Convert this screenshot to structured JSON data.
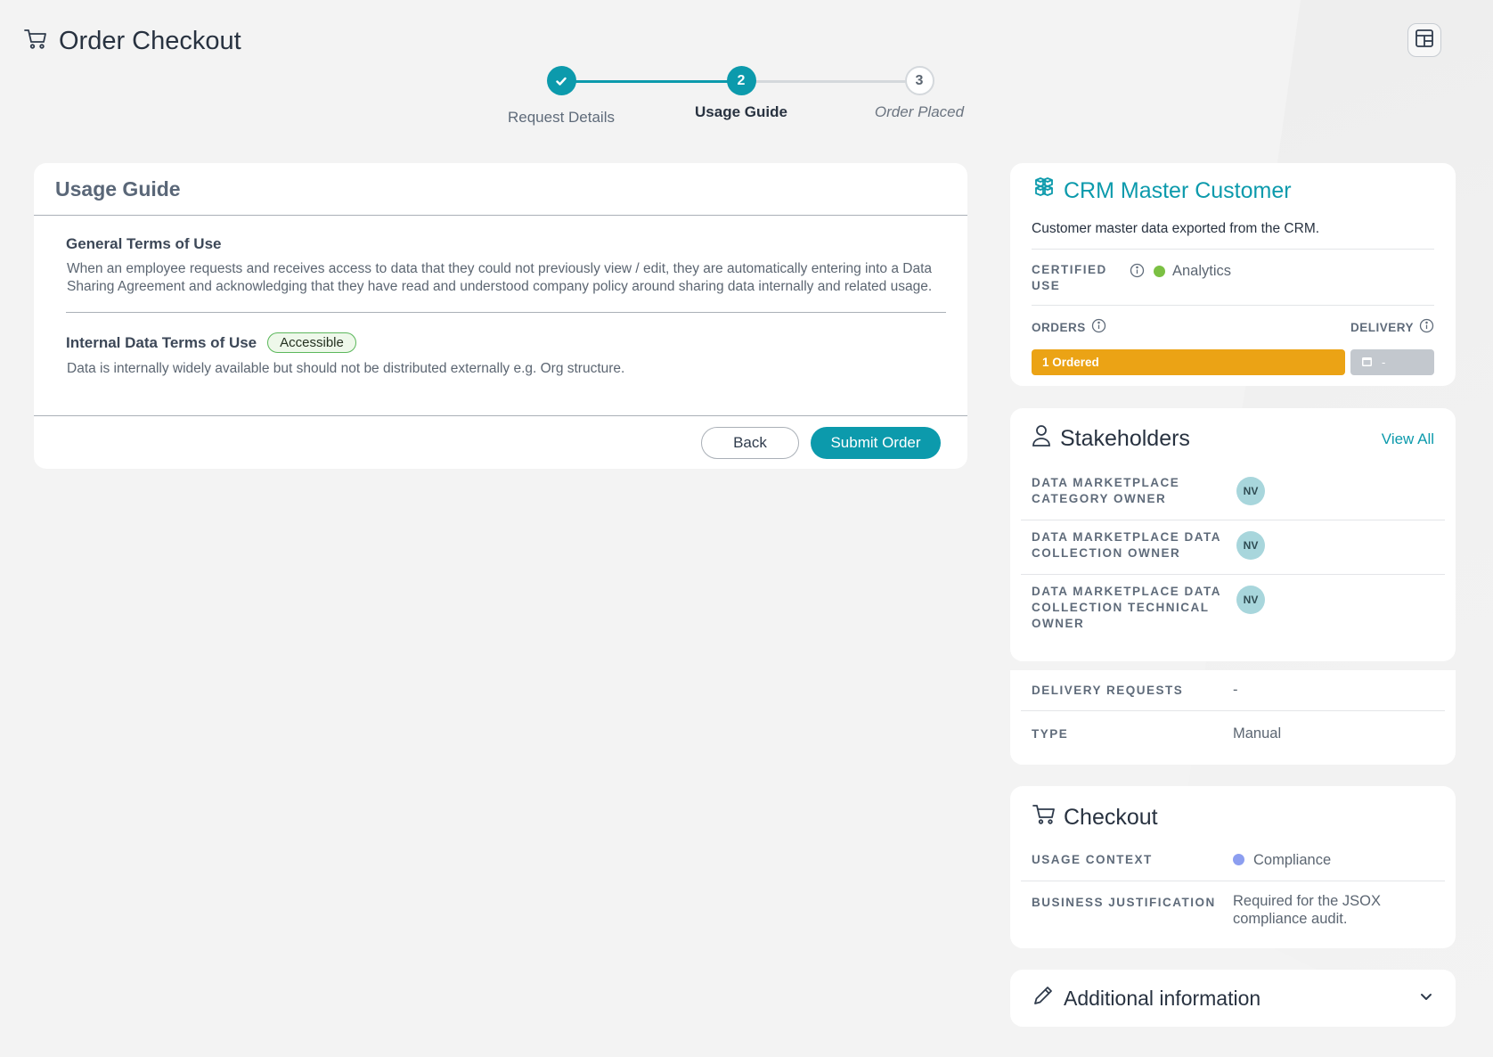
{
  "header": {
    "title": "Order Checkout",
    "icon": "cart-icon"
  },
  "stepper": {
    "steps": [
      {
        "label": "Request Details",
        "state": "complete",
        "number": "✓"
      },
      {
        "label": "Usage Guide",
        "state": "active",
        "number": "2"
      },
      {
        "label": "Order Placed",
        "state": "pending",
        "number": "3"
      }
    ]
  },
  "usage": {
    "title": "Usage Guide",
    "general_title": "General Terms of Use",
    "general_text": "When an employee requests and receives access to data that they could not previously view / edit, they are automatically entering into a Data Sharing Agreement and acknowledging that they have read and understood company policy around sharing data internally and related usage.",
    "internal_title": "Internal Data Terms of Use",
    "internal_badge": "Accessible",
    "internal_text": "Data is internally widely available but should not be distributed externally e.g. Org structure.",
    "back_label": "Back",
    "submit_label": "Submit Order"
  },
  "product": {
    "title": "CRM Master Customer",
    "description": "Customer master data exported from the CRM.",
    "certified_label": "CERTIFIED USE",
    "certified_value": "Analytics",
    "certified_color": "#7bc043",
    "orders_label": "ORDERS",
    "delivery_label": "DELIVERY",
    "ordered_text": "1 Ordered",
    "delivery_value": "-",
    "ordered_color": "#eba315"
  },
  "stakeholders": {
    "title": "Stakeholders",
    "view_all": "View All",
    "rows": [
      {
        "label": "DATA MARKETPLACE CATEGORY OWNER",
        "initials": "NV"
      },
      {
        "label": "DATA MARKETPLACE DATA COLLECTION OWNER",
        "initials": "NV"
      },
      {
        "label": "DATA MARKETPLACE DATA COLLECTION TECHNICAL OWNER",
        "initials": "NV"
      }
    ]
  },
  "details": {
    "delivery_requests_label": "DELIVERY REQUESTS",
    "delivery_requests_value": "-",
    "type_label": "TYPE",
    "type_value": "Manual"
  },
  "checkout": {
    "title": "Checkout",
    "usage_context_label": "USAGE CONTEXT",
    "usage_context_value": "Compliance",
    "usage_context_color": "#8c9ef0",
    "justification_label": "BUSINESS JUSTIFICATION",
    "justification_value": "Required for the JSOX compliance audit."
  },
  "additional": {
    "title": "Additional information"
  }
}
